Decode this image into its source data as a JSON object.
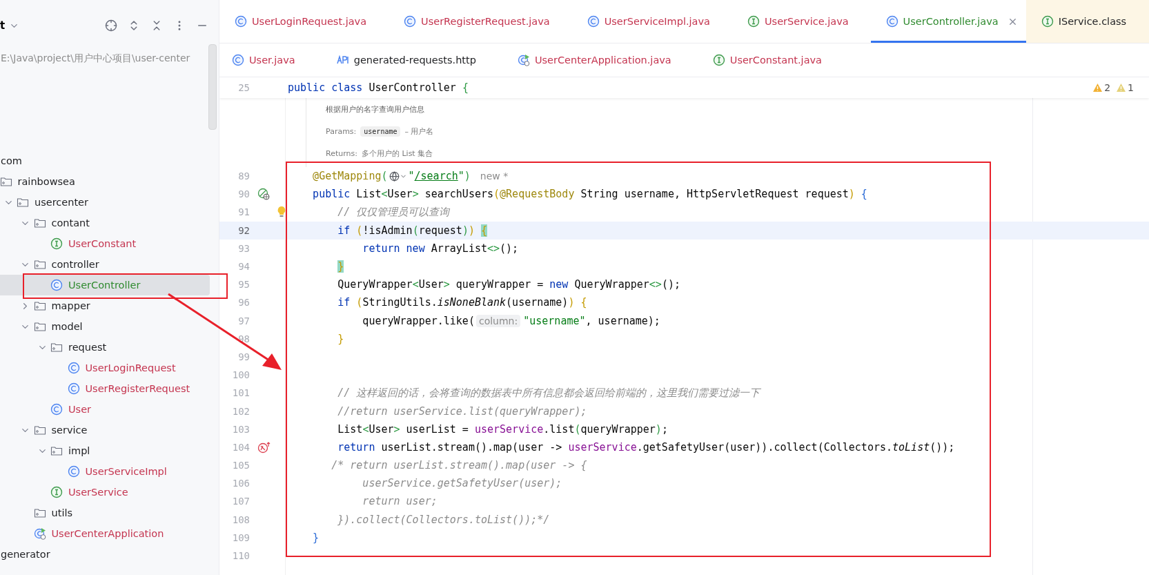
{
  "project_panel": {
    "title": "t",
    "path": "E:\\Java\\project\\用户中心项目\\user-center",
    "tree": [
      {
        "label": "com",
        "selected": false,
        "children": [
          {
            "label": "rainbowsea",
            "kind": "package",
            "selected": false,
            "children": [
              {
                "label": "usercenter",
                "kind": "package",
                "expanded": true,
                "selected": false,
                "children": [
                  {
                    "label": "contant",
                    "kind": "package",
                    "expanded": true,
                    "selected": false,
                    "children": [
                      {
                        "label": "UserConstant",
                        "kind": "interface",
                        "color": "#c4344f",
                        "selected": false
                      }
                    ]
                  },
                  {
                    "label": "controller",
                    "kind": "package",
                    "expanded": true,
                    "selected": false,
                    "children": [
                      {
                        "label": "UserController",
                        "kind": "class",
                        "color": "#2f8a2f",
                        "selected": true
                      }
                    ]
                  },
                  {
                    "label": "mapper",
                    "kind": "package",
                    "expanded": false,
                    "selected": false
                  },
                  {
                    "label": "model",
                    "kind": "package",
                    "expanded": true,
                    "selected": false,
                    "children": [
                      {
                        "label": "request",
                        "kind": "package",
                        "expanded": true,
                        "selected": false,
                        "children": [
                          {
                            "label": "UserLoginRequest",
                            "kind": "class",
                            "color": "#c4344f",
                            "selected": false
                          },
                          {
                            "label": "UserRegisterRequest",
                            "kind": "class",
                            "color": "#c4344f",
                            "selected": false
                          }
                        ]
                      },
                      {
                        "label": "User",
                        "kind": "class",
                        "color": "#c4344f",
                        "selected": false
                      }
                    ]
                  },
                  {
                    "label": "service",
                    "kind": "package",
                    "expanded": true,
                    "selected": false,
                    "children": [
                      {
                        "label": "impl",
                        "kind": "package",
                        "expanded": true,
                        "selected": false,
                        "children": [
                          {
                            "label": "UserServiceImpl",
                            "kind": "class",
                            "color": "#c4344f",
                            "selected": false
                          }
                        ]
                      },
                      {
                        "label": "UserService",
                        "kind": "interface",
                        "color": "#c4344f",
                        "selected": false
                      }
                    ]
                  },
                  {
                    "label": "utils",
                    "kind": "package",
                    "selected": false
                  },
                  {
                    "label": "UserCenterApplication",
                    "kind": "app",
                    "color": "#c4344f",
                    "selected": false
                  }
                ]
              }
            ]
          }
        ]
      },
      {
        "label": "generator",
        "selected": false
      }
    ]
  },
  "tab_rows": [
    [
      {
        "label": "UserLoginRequest.java",
        "kind": "class",
        "color": "#c4344f",
        "library": false,
        "selected": false
      },
      {
        "label": "UserRegisterRequest.java",
        "kind": "class",
        "color": "#c4344f",
        "library": false,
        "selected": false
      },
      {
        "label": "UserServiceImpl.java",
        "kind": "class",
        "color": "#c4344f",
        "library": false,
        "selected": false
      },
      {
        "label": "UserService.java",
        "kind": "interface",
        "color": "#c4344f",
        "library": false,
        "selected": false
      },
      {
        "label": "UserController.java",
        "kind": "class",
        "color": "#2f8a2f",
        "library": false,
        "selected": true
      },
      {
        "label": "IService.class",
        "kind": "interface",
        "color": "#1e1f22",
        "library": true,
        "selected": false
      }
    ],
    [
      {
        "label": "User.java",
        "kind": "class",
        "color": "#c4344f",
        "library": false,
        "selected": false
      },
      {
        "label": "generated-requests.http",
        "kind": "api",
        "color": "#1e1f22",
        "library": false,
        "selected": false
      },
      {
        "label": "UserCenterApplication.java",
        "kind": "app",
        "color": "#c4344f",
        "library": false,
        "selected": false
      },
      {
        "label": "UserConstant.java",
        "kind": "interface",
        "color": "#c4344f",
        "library": false,
        "selected": false
      }
    ]
  ],
  "sticky_line": {
    "number": "25",
    "tokens": [
      {
        "kind": "kw",
        "text": "public class "
      },
      {
        "kind": "p",
        "text": "UserController "
      },
      {
        "kind": "brg",
        "text": "{"
      }
    ]
  },
  "inspections": [
    {
      "kind": "warning",
      "count": "2"
    },
    {
      "kind": "weak",
      "count": "1"
    }
  ],
  "doc": {
    "summary": "根据用户的名字查询用户信息",
    "params_label": "Params:",
    "param_name": "username",
    "param_desc": "– 用户名",
    "returns_label": "Returns:",
    "returns_desc": "多个用户的 List 集合"
  },
  "lines": [
    {
      "number": "89",
      "kind": "code",
      "current": false,
      "tokens": [
        {
          "kind": "ann",
          "text": "    @GetMapping"
        },
        {
          "kind": "brg",
          "text": "("
        },
        {
          "kind": "globe"
        },
        {
          "kind": "str",
          "text": "\""
        },
        {
          "kind": "link",
          "text": "/search"
        },
        {
          "kind": "str",
          "text": "\""
        },
        {
          "kind": "brg",
          "text": ")"
        },
        {
          "kind": "note",
          "text": "new *"
        }
      ]
    },
    {
      "number": "90",
      "kind": "endpoint",
      "current": false,
      "tokens": [
        {
          "kind": "kw",
          "text": "    public "
        },
        {
          "kind": "p",
          "text": "List"
        },
        {
          "kind": "brg",
          "text": "<"
        },
        {
          "kind": "p",
          "text": "User"
        },
        {
          "kind": "brg",
          "text": ">"
        },
        {
          "kind": "p",
          "text": " searchUsers"
        },
        {
          "kind": "bra",
          "text": "("
        },
        {
          "kind": "ann",
          "text": "@RequestBody"
        },
        {
          "kind": "p",
          "text": " String username, HttpServletRequest request"
        },
        {
          "kind": "bra",
          "text": ")"
        },
        {
          "kind": "brb",
          "text": " {"
        }
      ]
    },
    {
      "number": "91",
      "kind": "bulb",
      "current": false,
      "tokens": [
        {
          "kind": "cmt",
          "text": "        // 仅仅管理员可以查询"
        }
      ]
    },
    {
      "number": "92",
      "kind": "code",
      "current": true,
      "tokens": [
        {
          "kind": "kw",
          "text": "        if "
        },
        {
          "kind": "bra",
          "text": "("
        },
        {
          "kind": "p",
          "text": "!isAdmin"
        },
        {
          "kind": "brg",
          "text": "("
        },
        {
          "kind": "p",
          "text": "request"
        },
        {
          "kind": "brg",
          "text": ")"
        },
        {
          "kind": "bra",
          "text": ")"
        },
        {
          "kind": "match",
          "text": " {"
        }
      ]
    },
    {
      "number": "93",
      "kind": "code",
      "current": false,
      "tokens": [
        {
          "kind": "kw",
          "text": "            return new "
        },
        {
          "kind": "p",
          "text": "ArrayList"
        },
        {
          "kind": "brg",
          "text": "<>"
        },
        {
          "kind": "p",
          "text": "();"
        }
      ]
    },
    {
      "number": "94",
      "kind": "code",
      "current": false,
      "tokens": [
        {
          "kind": "match",
          "text": "        }"
        }
      ]
    },
    {
      "number": "95",
      "kind": "code",
      "current": false,
      "tokens": [
        {
          "kind": "p",
          "text": "        QueryWrapper"
        },
        {
          "kind": "brg",
          "text": "<"
        },
        {
          "kind": "p",
          "text": "User"
        },
        {
          "kind": "brg",
          "text": ">"
        },
        {
          "kind": "p",
          "text": " queryWrapper = "
        },
        {
          "kind": "kw",
          "text": "new "
        },
        {
          "kind": "p",
          "text": "QueryWrapper"
        },
        {
          "kind": "brg",
          "text": "<>"
        },
        {
          "kind": "p",
          "text": "();"
        }
      ]
    },
    {
      "number": "96",
      "kind": "code",
      "current": false,
      "tokens": [
        {
          "kind": "kw",
          "text": "        if "
        },
        {
          "kind": "bra",
          "text": "("
        },
        {
          "kind": "p",
          "text": "StringUtils."
        },
        {
          "kind": "it",
          "text": "isNoneBlank"
        },
        {
          "kind": "p",
          "text": "(username)"
        },
        {
          "kind": "bra",
          "text": ")"
        },
        {
          "kind": "bra",
          "text": " {"
        }
      ]
    },
    {
      "number": "97",
      "kind": "code",
      "current": false,
      "tokens": [
        {
          "kind": "p",
          "text": "            queryWrapper.like("
        },
        {
          "kind": "hint",
          "text": "column:"
        },
        {
          "kind": "str",
          "text": "\"username\""
        },
        {
          "kind": "p",
          "text": ", username);"
        }
      ]
    },
    {
      "number": "98",
      "kind": "code",
      "current": false,
      "tokens": [
        {
          "kind": "bra",
          "text": "        }"
        }
      ]
    },
    {
      "number": "99",
      "kind": "code",
      "current": false
    },
    {
      "number": "100",
      "kind": "code",
      "current": false
    },
    {
      "number": "101",
      "kind": "code",
      "current": false,
      "tokens": [
        {
          "kind": "cmt",
          "text": "        // 这样返回的话，会将查询的数据表中所有信息都会返回给前端的，这里我们需要过滤一下"
        }
      ]
    },
    {
      "number": "102",
      "kind": "code",
      "current": false,
      "tokens": [
        {
          "kind": "cmt",
          "text": "        //return userService.list(queryWrapper);"
        }
      ]
    },
    {
      "number": "103",
      "kind": "code",
      "current": false,
      "tokens": [
        {
          "kind": "p",
          "text": "        List"
        },
        {
          "kind": "brg",
          "text": "<"
        },
        {
          "kind": "p",
          "text": "User"
        },
        {
          "kind": "brg",
          "text": ">"
        },
        {
          "kind": "p",
          "text": " userList = "
        },
        {
          "kind": "fld",
          "text": "userService"
        },
        {
          "kind": "p",
          "text": ".list"
        },
        {
          "kind": "brg",
          "text": "("
        },
        {
          "kind": "p",
          "text": "queryWrapper"
        },
        {
          "kind": "brg",
          "text": ")"
        },
        {
          "kind": "p",
          "text": ";"
        }
      ]
    },
    {
      "number": "104",
      "kind": "recursion",
      "current": false,
      "tokens": [
        {
          "kind": "kw",
          "text": "        return "
        },
        {
          "kind": "p",
          "text": "userList.stream().map(user -> "
        },
        {
          "kind": "fld",
          "text": "userService"
        },
        {
          "kind": "p",
          "text": ".getSafetyUser(user)).collect(Collectors."
        },
        {
          "kind": "it",
          "text": "toList"
        },
        {
          "kind": "p",
          "text": "());"
        }
      ]
    },
    {
      "number": "105",
      "kind": "code",
      "current": false,
      "tokens": [
        {
          "kind": "cmt",
          "text": "       /* return userList.stream().map(user -> {"
        }
      ]
    },
    {
      "number": "106",
      "kind": "code",
      "current": false,
      "tokens": [
        {
          "kind": "cmt",
          "text": "            userService.getSafetyUser(user);"
        }
      ]
    },
    {
      "number": "107",
      "kind": "code",
      "current": false,
      "tokens": [
        {
          "kind": "cmt",
          "text": "            return user;"
        }
      ]
    },
    {
      "number": "108",
      "kind": "code",
      "current": false,
      "tokens": [
        {
          "kind": "cmt",
          "text": "        }).collect(Collectors.toList());*/"
        }
      ]
    },
    {
      "number": "109",
      "kind": "code",
      "current": false,
      "tokens": [
        {
          "kind": "brb",
          "text": "    }"
        }
      ]
    },
    {
      "number": "110",
      "kind": "code",
      "current": false
    }
  ]
}
